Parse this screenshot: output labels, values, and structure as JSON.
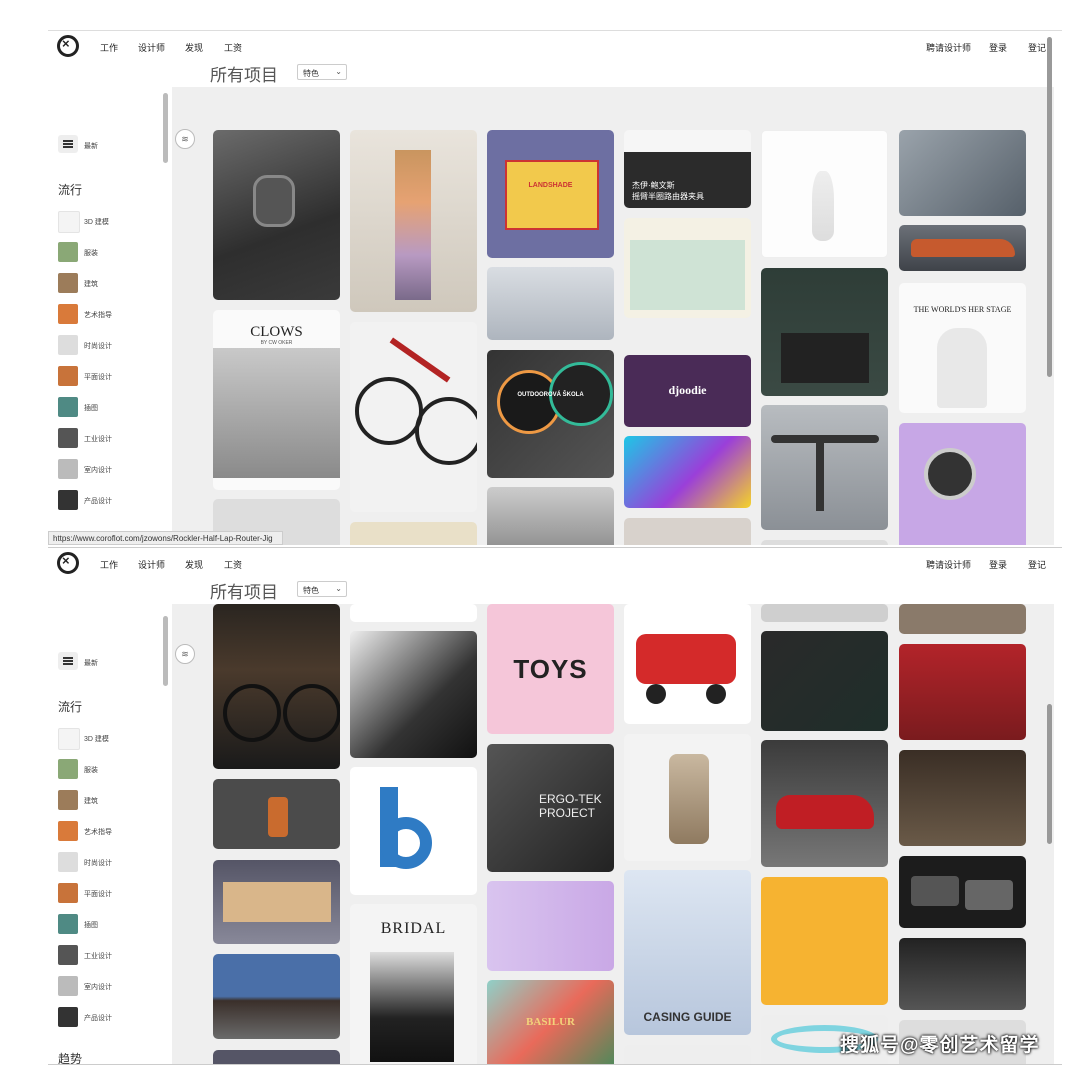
{
  "nav": {
    "items": [
      "工作",
      "设计师",
      "发现",
      "工资"
    ],
    "right": [
      "聘请设计师",
      "登录",
      "登记"
    ]
  },
  "page_title": "所有项目",
  "filter_select": "特色",
  "sidebar": {
    "new_label": "最新",
    "section_popular": "流行",
    "section_trending": "趋势",
    "categories": [
      "3D 建模",
      "服装",
      "建筑",
      "艺术指导",
      "时尚设计",
      "平面设计",
      "插图",
      "工业设计",
      "室内设计",
      "产品设计"
    ]
  },
  "cards_top": {
    "clows": "CLOWS",
    "clows_sub": "BY CW OKER",
    "jig_title": "杰伊·鲍文斯",
    "jig_sub": "摇臂半圈路由器夹具",
    "djoodie": "djoodie",
    "landshade": "LANDSHADE",
    "outdoor": "OUTDOOROVÁ ŠKOLA",
    "world_stage": "THE WORLD'S HER STAGE"
  },
  "cards_bottom": {
    "toys": "TOYS",
    "ergotek_1": "ERGO-TEK",
    "ergotek_2": "PROJECT",
    "bridal": "BRIDAL",
    "casing_guide": "CASING GUIDE",
    "basilur": "BASILUR"
  },
  "status_url": "https://www.coroflot.com/jzowons/Rockler-Half-Lap-Router-Jig",
  "watermark": "搜狐号@零创艺术留学"
}
